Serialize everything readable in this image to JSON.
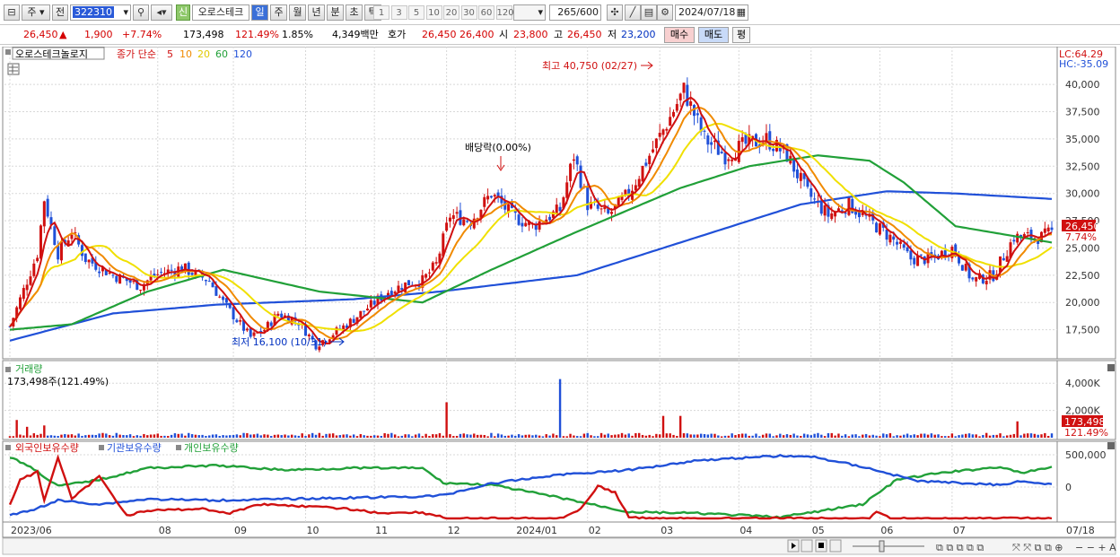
{
  "toolbar": {
    "period_week": "주",
    "prev_label": "전",
    "code_value": "322310",
    "new_badge": "신",
    "stock_name": "오로스테크",
    "tabs": [
      "일",
      "주",
      "월",
      "년",
      "분",
      "초",
      "틱"
    ],
    "active_tab": "일",
    "intervals": [
      "1",
      "3",
      "5",
      "10",
      "20",
      "30",
      "60",
      "120"
    ],
    "count": "265",
    "count_total": "/600",
    "date": "2024/07/18"
  },
  "quote": {
    "price": "26,450",
    "change": "1,900",
    "change_pct": "+7.74%",
    "volume": "173,498",
    "vol_ratio": "121.49%",
    "turnover": "1.85%",
    "amount": "4,349백만",
    "ask_label": "호가",
    "ask": "26,450",
    "bid": "26,400",
    "open_label": "시",
    "open": "23,800",
    "high_label": "고",
    "high": "26,450",
    "low_label": "저",
    "low": "23,200",
    "buy_button": "매수",
    "sell_button": "매도",
    "eval_button": "평"
  },
  "legend": {
    "stock_name": "오로스테크놀로지",
    "ma_prefix": "종가 단순",
    "ma_periods": [
      "5",
      "10",
      "20",
      "60",
      "120"
    ],
    "ma_colors": [
      "#d01010",
      "#f08a00",
      "#f0e000",
      "#21a038",
      "#2050d8"
    ],
    "lc": "LC:64.29",
    "hc": "HC:-35.09",
    "high_annot": "최고 40,750 (02/27)",
    "low_annot": "최저 16,100 (10/31)",
    "div_annot": "배당락(0.00%)",
    "price_tag": "26,450",
    "pct_tag": "7.74%"
  },
  "volume_panel": {
    "title": "거래량",
    "value": "173,498주(121.49%)",
    "tag_value": "173,498",
    "tag_pct": "121.49%"
  },
  "holdings_panel": {
    "series_names": [
      "외국인보유수량",
      "기관보유수량",
      "개인보유수량"
    ],
    "series_colors": [
      "#d01010",
      "#2050d8",
      "#21a038"
    ]
  },
  "colors": {
    "up": "#d01010",
    "down": "#2050d8",
    "grid": "#c8c8c8"
  },
  "chart_data": {
    "type": "candlestick",
    "y_ticks": [
      "40,000",
      "37,500",
      "35,000",
      "32,500",
      "30,000",
      "27,500",
      "25,000",
      "22,500",
      "20,000",
      "17,500"
    ],
    "y_range": [
      15000,
      41000
    ],
    "volume_ticks": [
      "4,000K",
      "2,000K"
    ],
    "volume_range": [
      0,
      5000
    ],
    "holdings_ticks": [
      "500,000",
      "0"
    ],
    "x_labels": [
      "2023/06",
      "08",
      "09",
      "10",
      "11",
      "12",
      "2024/01",
      "02",
      "03",
      "04",
      "05",
      "06",
      "07",
      "07/18"
    ],
    "price_anchors": [
      [
        0,
        17800
      ],
      [
        8,
        24500
      ],
      [
        10,
        29500
      ],
      [
        14,
        24500
      ],
      [
        18,
        26500
      ],
      [
        22,
        24000
      ],
      [
        30,
        22500
      ],
      [
        38,
        21500
      ],
      [
        42,
        22500
      ],
      [
        50,
        23200
      ],
      [
        58,
        22000
      ],
      [
        62,
        20000
      ],
      [
        70,
        16800
      ],
      [
        74,
        17500
      ],
      [
        78,
        19000
      ],
      [
        84,
        18200
      ],
      [
        89,
        16100
      ],
      [
        98,
        18000
      ],
      [
        104,
        19500
      ],
      [
        110,
        21000
      ],
      [
        116,
        21800
      ],
      [
        120,
        22000
      ],
      [
        124,
        23500
      ],
      [
        128,
        28000
      ],
      [
        134,
        27500
      ],
      [
        140,
        30000
      ],
      [
        146,
        28000
      ],
      [
        152,
        27000
      ],
      [
        160,
        28500
      ],
      [
        164,
        33500
      ],
      [
        168,
        29000
      ],
      [
        174,
        28000
      ],
      [
        180,
        30000
      ],
      [
        186,
        33500
      ],
      [
        192,
        37000
      ],
      [
        196,
        39500
      ],
      [
        202,
        35000
      ],
      [
        208,
        33500
      ],
      [
        214,
        34500
      ],
      [
        220,
        35000
      ],
      [
        226,
        33500
      ],
      [
        232,
        30000
      ],
      [
        238,
        28000
      ],
      [
        244,
        29000
      ],
      [
        250,
        27500
      ],
      [
        256,
        26000
      ],
      [
        262,
        24000
      ],
      [
        268,
        24000
      ],
      [
        274,
        25000
      ],
      [
        280,
        22000
      ],
      [
        286,
        22500
      ],
      [
        292,
        26000
      ],
      [
        300,
        26000
      ],
      [
        303,
        26450
      ]
    ],
    "ma60_anchors": [
      [
        0,
        17500
      ],
      [
        18,
        18000
      ],
      [
        40,
        21000
      ],
      [
        62,
        23000
      ],
      [
        90,
        21000
      ],
      [
        120,
        20000
      ],
      [
        140,
        23000
      ],
      [
        165,
        26500
      ],
      [
        195,
        30500
      ],
      [
        215,
        32500
      ],
      [
        235,
        33500
      ],
      [
        250,
        33000
      ],
      [
        260,
        31000
      ],
      [
        275,
        27000
      ],
      [
        303,
        25500
      ]
    ],
    "ma120_anchors": [
      [
        0,
        16500
      ],
      [
        30,
        19000
      ],
      [
        60,
        19800
      ],
      [
        100,
        20300
      ],
      [
        125,
        21000
      ],
      [
        165,
        22500
      ],
      [
        200,
        26000
      ],
      [
        230,
        29000
      ],
      [
        255,
        30200
      ],
      [
        275,
        30000
      ],
      [
        303,
        29500
      ]
    ],
    "volume_spikes": [
      [
        2,
        1300
      ],
      [
        5,
        800
      ],
      [
        10,
        900
      ],
      [
        127,
        2600
      ],
      [
        160,
        4300
      ],
      [
        190,
        1600
      ],
      [
        195,
        1600
      ],
      [
        293,
        1200
      ]
    ],
    "holdings_foreign": [
      [
        0,
        0.78
      ],
      [
        3,
        0.4
      ],
      [
        8,
        0.28
      ],
      [
        10,
        0.72
      ],
      [
        14,
        0.05
      ],
      [
        18,
        0.7
      ],
      [
        26,
        0.35
      ],
      [
        34,
        0.95
      ],
      [
        40,
        0.88
      ],
      [
        56,
        0.85
      ],
      [
        64,
        0.92
      ],
      [
        72,
        0.78
      ],
      [
        82,
        0.8
      ],
      [
        98,
        0.85
      ],
      [
        108,
        0.92
      ],
      [
        118,
        0.9
      ],
      [
        124,
        0.95
      ],
      [
        127,
        1.0
      ],
      [
        160,
        1.0
      ],
      [
        166,
        0.85
      ],
      [
        171,
        0.5
      ],
      [
        176,
        0.6
      ],
      [
        180,
        0.98
      ],
      [
        186,
        1.0
      ],
      [
        250,
        1.0
      ],
      [
        252,
        0.9
      ],
      [
        256,
        1.0
      ],
      [
        303,
        1.0
      ]
    ],
    "holdings_institution": [
      [
        0,
        0.95
      ],
      [
        6,
        0.88
      ],
      [
        14,
        0.72
      ],
      [
        26,
        0.78
      ],
      [
        40,
        0.7
      ],
      [
        60,
        0.72
      ],
      [
        80,
        0.7
      ],
      [
        100,
        0.68
      ],
      [
        120,
        0.66
      ],
      [
        126,
        0.64
      ],
      [
        140,
        0.46
      ],
      [
        160,
        0.32
      ],
      [
        180,
        0.25
      ],
      [
        200,
        0.1
      ],
      [
        224,
        0.03
      ],
      [
        234,
        0.05
      ],
      [
        248,
        0.2
      ],
      [
        264,
        0.42
      ],
      [
        272,
        0.44
      ],
      [
        288,
        0.48
      ],
      [
        294,
        0.42
      ],
      [
        303,
        0.48
      ]
    ],
    "holdings_individual": [
      [
        0,
        0.05
      ],
      [
        6,
        0.2
      ],
      [
        14,
        0.5
      ],
      [
        26,
        0.4
      ],
      [
        40,
        0.22
      ],
      [
        60,
        0.18
      ],
      [
        80,
        0.25
      ],
      [
        100,
        0.22
      ],
      [
        120,
        0.22
      ],
      [
        126,
        0.45
      ],
      [
        140,
        0.48
      ],
      [
        160,
        0.68
      ],
      [
        180,
        0.9
      ],
      [
        200,
        0.92
      ],
      [
        224,
        0.98
      ],
      [
        234,
        0.9
      ],
      [
        248,
        0.78
      ],
      [
        258,
        0.4
      ],
      [
        270,
        0.3
      ],
      [
        288,
        0.2
      ],
      [
        294,
        0.3
      ],
      [
        303,
        0.2
      ]
    ]
  }
}
